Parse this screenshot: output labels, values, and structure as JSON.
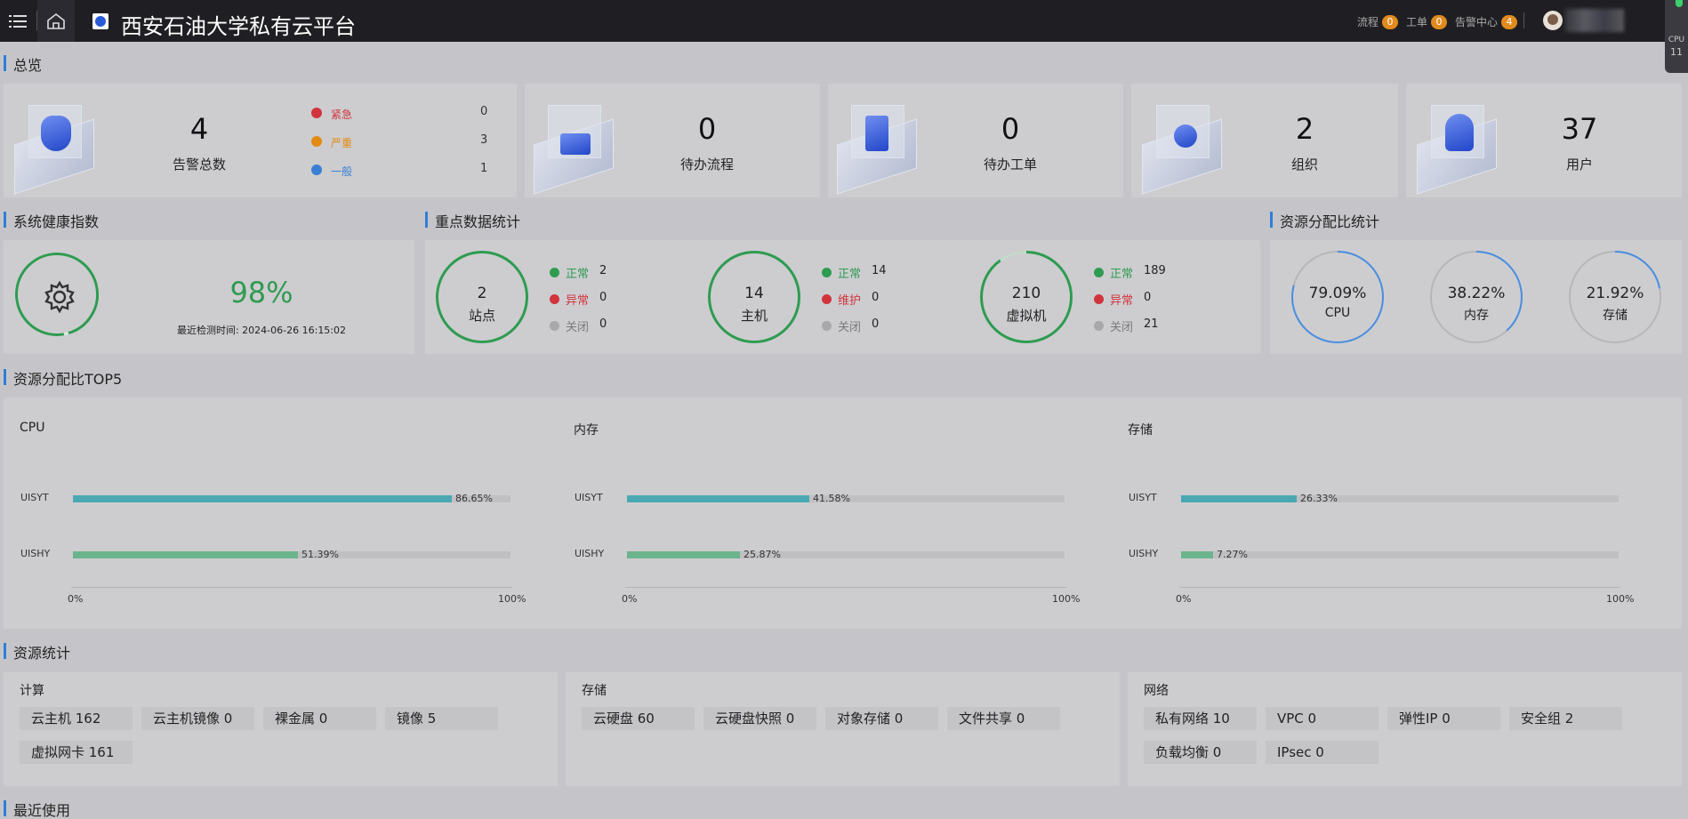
{
  "app": {
    "title": "西安石油大学私有云平台"
  },
  "header": {
    "nav": [
      {
        "label": "流程",
        "count": "0"
      },
      {
        "label": "工单",
        "count": "0"
      },
      {
        "label": "告警中心",
        "count": "4"
      }
    ],
    "side_tab": {
      "text1": "CPU",
      "text2": "11"
    }
  },
  "sections": {
    "overview": "总览",
    "health": "系统健康指数",
    "key_stats": "重点数据统计",
    "resource_ratio": "资源分配比统计",
    "top5": "资源分配比TOP5",
    "resource_stats": "资源统计",
    "recent": "最近使用"
  },
  "overview": {
    "alarm": {
      "total": "4",
      "label": "告警总数",
      "levels": [
        {
          "label": "紧急",
          "value": "0",
          "color": "#d1343c"
        },
        {
          "label": "严重",
          "value": "3",
          "color": "#e28a12"
        },
        {
          "label": "一般",
          "value": "1",
          "color": "#3a7fd4"
        }
      ]
    },
    "cards": [
      {
        "value": "0",
        "label": "待办流程"
      },
      {
        "value": "0",
        "label": "待办工单"
      },
      {
        "value": "2",
        "label": "组织"
      },
      {
        "value": "37",
        "label": "用户"
      }
    ]
  },
  "health": {
    "score": "98%",
    "score_fraction": 0.98,
    "time_text": "最近检测时间: 2024-06-26 16:15:02"
  },
  "key_stats": [
    {
      "value": "2",
      "label": "站点",
      "ring_fraction": 1.0,
      "rows": [
        {
          "label": "正常",
          "value": "2",
          "color": "#2f9b51"
        },
        {
          "label": "异常",
          "value": "0",
          "color": "#d1343c"
        },
        {
          "label": "关闭",
          "value": "0",
          "color": "#a8a8ab"
        }
      ]
    },
    {
      "value": "14",
      "label": "主机",
      "ring_fraction": 1.0,
      "rows": [
        {
          "label": "正常",
          "value": "14",
          "color": "#2f9b51"
        },
        {
          "label": "维护",
          "value": "0",
          "color": "#d1343c"
        },
        {
          "label": "关闭",
          "value": "0",
          "color": "#a8a8ab"
        }
      ]
    },
    {
      "value": "210",
      "label": "虚拟机",
      "ring_fraction": 0.9,
      "rows": [
        {
          "label": "正常",
          "value": "189",
          "color": "#2f9b51"
        },
        {
          "label": "异常",
          "value": "0",
          "color": "#d1343c"
        },
        {
          "label": "关闭",
          "value": "21",
          "color": "#a8a8ab"
        }
      ]
    }
  ],
  "resource_ratio": [
    {
      "value": "79.09%",
      "label": "CPU",
      "fraction": 0.7909
    },
    {
      "value": "38.22%",
      "label": "内存",
      "fraction": 0.3822
    },
    {
      "value": "21.92%",
      "label": "存储",
      "fraction": 0.2192
    }
  ],
  "top5": {
    "axis_min": "0%",
    "axis_max": "100%",
    "groups": [
      {
        "title": "CPU",
        "bars": [
          {
            "name": "UISYT",
            "value": "86.65%",
            "fraction": 0.8665,
            "color": "#4aa8b2"
          },
          {
            "name": "UISHY",
            "value": "51.39%",
            "fraction": 0.5139,
            "color": "#6cb48c"
          }
        ]
      },
      {
        "title": "内存",
        "bars": [
          {
            "name": "UISYT",
            "value": "41.58%",
            "fraction": 0.4158,
            "color": "#4aa8b2"
          },
          {
            "name": "UISHY",
            "value": "25.87%",
            "fraction": 0.2587,
            "color": "#6cb48c"
          }
        ]
      },
      {
        "title": "存储",
        "bars": [
          {
            "name": "UISYT",
            "value": "26.33%",
            "fraction": 0.2633,
            "color": "#4aa8b2"
          },
          {
            "name": "UISHY",
            "value": "7.27%",
            "fraction": 0.0727,
            "color": "#6cb48c"
          }
        ]
      }
    ]
  },
  "resource_stats": [
    {
      "title": "计算",
      "items": [
        "云主机  162",
        "云主机镜像  0",
        "裸金属  0",
        "镜像  5",
        "虚拟网卡  161"
      ]
    },
    {
      "title": "存储",
      "items": [
        "云硬盘  60",
        "云硬盘快照  0",
        "对象存储  0",
        "文件共享  0"
      ]
    },
    {
      "title": "网络",
      "items": [
        "私有网络  10",
        "VPC  0",
        "弹性IP  0",
        "安全组  2",
        "负载均衡  0",
        "IPsec  0"
      ]
    }
  ]
}
